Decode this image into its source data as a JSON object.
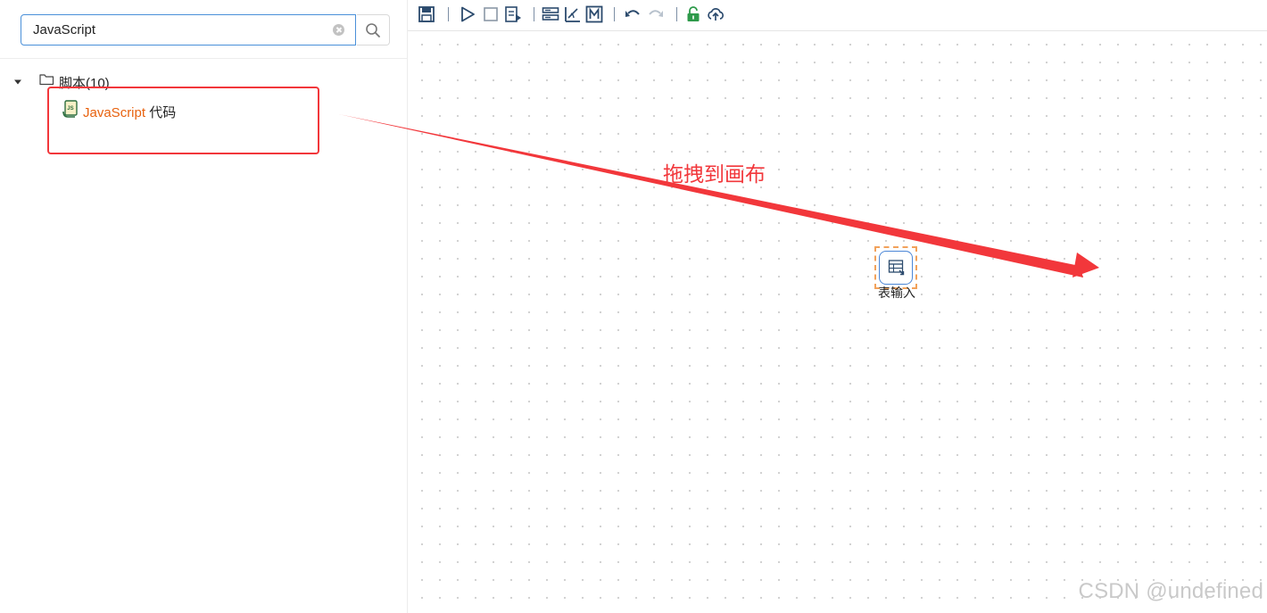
{
  "search": {
    "value": "JavaScript",
    "clear_icon": "clear-circle-icon",
    "button_icon": "search-icon"
  },
  "tree": {
    "folder": {
      "label": "脚本(10)",
      "expanded": true,
      "icon": "folder-icon"
    },
    "items": [
      {
        "highlight": "JavaScript",
        "rest": " 代码",
        "icon": "javascript-file-icon"
      }
    ]
  },
  "toolbar": {
    "buttons": [
      "save-icon",
      "run-icon",
      "stop-icon",
      "preview-icon",
      "layers-icon",
      "align-icon",
      "metadata-icon",
      "undo-icon",
      "redo-icon",
      "unlock-icon",
      "cloud-upload-icon"
    ]
  },
  "canvas": {
    "annotation": "拖拽到画布",
    "node": {
      "label": "表输入",
      "icon": "table-input-icon"
    }
  },
  "colors": {
    "accent_blue": "#4a90d9",
    "highlight_orange": "#e8620f",
    "annotation_red": "#f2373b",
    "toolbar_icon": "#2b4a6d"
  },
  "watermark": "CSDN @undefined"
}
